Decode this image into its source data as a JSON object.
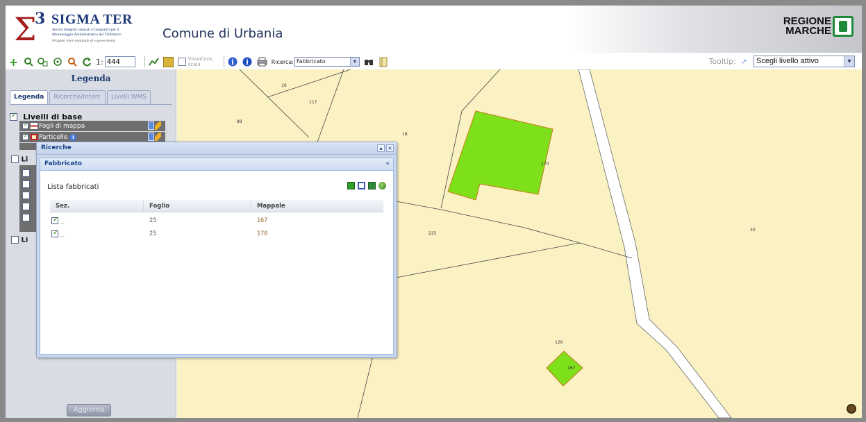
{
  "header": {
    "logo": {
      "glyph": "Σ",
      "superscript": "3",
      "title": "SIGMA TER",
      "subtitle_line1": "Servizi Integrati catastali e Geografici per il",
      "subtitle_line2": "Monitoraggio Amministrativo del TERritorio",
      "subtitle_line3": "Progetto inter-regionale di e-government"
    },
    "app_title": "Comune di Urbania",
    "region_logo_line1": "REGIONE",
    "region_logo_line2": "MARCHE"
  },
  "toolbar": {
    "icons": [
      "add-icon",
      "zoom-in-icon",
      "zoom-box-icon",
      "zoom-full-icon",
      "zoom-out-icon",
      "refresh-icon"
    ],
    "scale_prefix": "1:",
    "scale_value": "444",
    "visualizza_scala_line1": "Visualizza",
    "visualizza_scala_line2": "scala",
    "ricerca_label": "Ricerca:",
    "ricerca_value": "Fabbricato",
    "tooltip_label": "Tooltip:",
    "tooltip_value": "Scegli livello attivo"
  },
  "leftpanel": {
    "title": "Legenda",
    "tabs": [
      {
        "label": "Legenda",
        "active": true
      },
      {
        "label": "Ricerche/Interr.",
        "active": false
      },
      {
        "label": "Livelli WMS",
        "active": false
      }
    ],
    "base_group_label": "Livelli di base",
    "layers": [
      {
        "name": "Fogli di mappa"
      },
      {
        "name": "Particelle"
      }
    ],
    "group_stub": "Li",
    "update_button": "Aggiorna"
  },
  "dialog": {
    "title": "Ricerche",
    "subtitle": "Fabbricato",
    "collapse_glyph": "«",
    "list_title": "Lista fabbricati",
    "columns": [
      "Sez.",
      "Foglio",
      "Mappale"
    ],
    "rows": [
      {
        "sez": "_",
        "foglio": "25",
        "mappale": "167"
      },
      {
        "sez": "_",
        "foglio": "25",
        "mappale": "170"
      }
    ]
  },
  "map": {
    "labels": [
      "16",
      "117",
      "89",
      "18",
      "170",
      "225",
      "30",
      "126",
      "167"
    ]
  },
  "colors": {
    "map_background": "#fbf2c4",
    "building_fill": "#7ee01b",
    "building_stroke": "#c87a1a",
    "road": "#ffffff",
    "panel_bg": "#d9dce3",
    "accent": "#15428b"
  }
}
